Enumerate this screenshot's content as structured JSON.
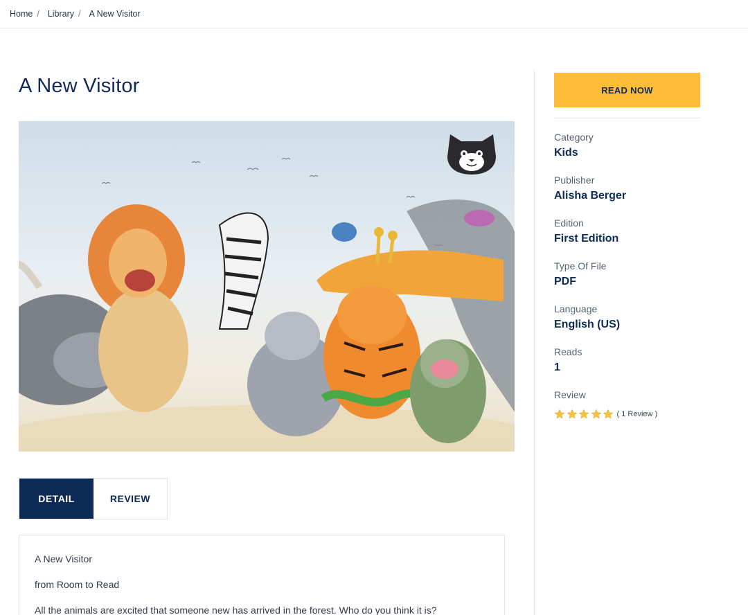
{
  "breadcrumb": {
    "items": [
      "Home",
      "Library",
      "A New Visitor"
    ],
    "separator": "/"
  },
  "book": {
    "title": "A New Visitor",
    "cover_alt": "Watercolor illustration of laughing animals: buffalo, lion, zebra, hyena, giraffe, tiger, birds, snake, monkey, elephant trunk"
  },
  "tabs": [
    {
      "label": "DETAIL",
      "active": true
    },
    {
      "label": "REVIEW",
      "active": false
    }
  ],
  "detail": {
    "lines": [
      "A New Visitor",
      "from Room to Read",
      "All the animals are excited that someone new has arrived in the forest. Who do you think it is?"
    ]
  },
  "sidebar": {
    "read_button": "READ NOW",
    "meta": [
      {
        "label": "Category",
        "value": "Kids"
      },
      {
        "label": "Publisher",
        "value": "Alisha Berger"
      },
      {
        "label": "Edition",
        "value": "First Edition"
      },
      {
        "label": "Type Of File",
        "value": "PDF"
      },
      {
        "label": "Language",
        "value": "English (US)"
      },
      {
        "label": "Reads",
        "value": "1"
      }
    ],
    "review_label": "Review",
    "rating_stars": 5,
    "rating_max": 5,
    "review_count_text": "( 1 Review )"
  },
  "colors": {
    "navy": "#0e2b58",
    "accent_yellow": "#fdbd39",
    "star": "#f6c343",
    "border": "#dfe2e8"
  },
  "icons": {
    "logo": "cat-face-icon",
    "star": "star-icon"
  }
}
